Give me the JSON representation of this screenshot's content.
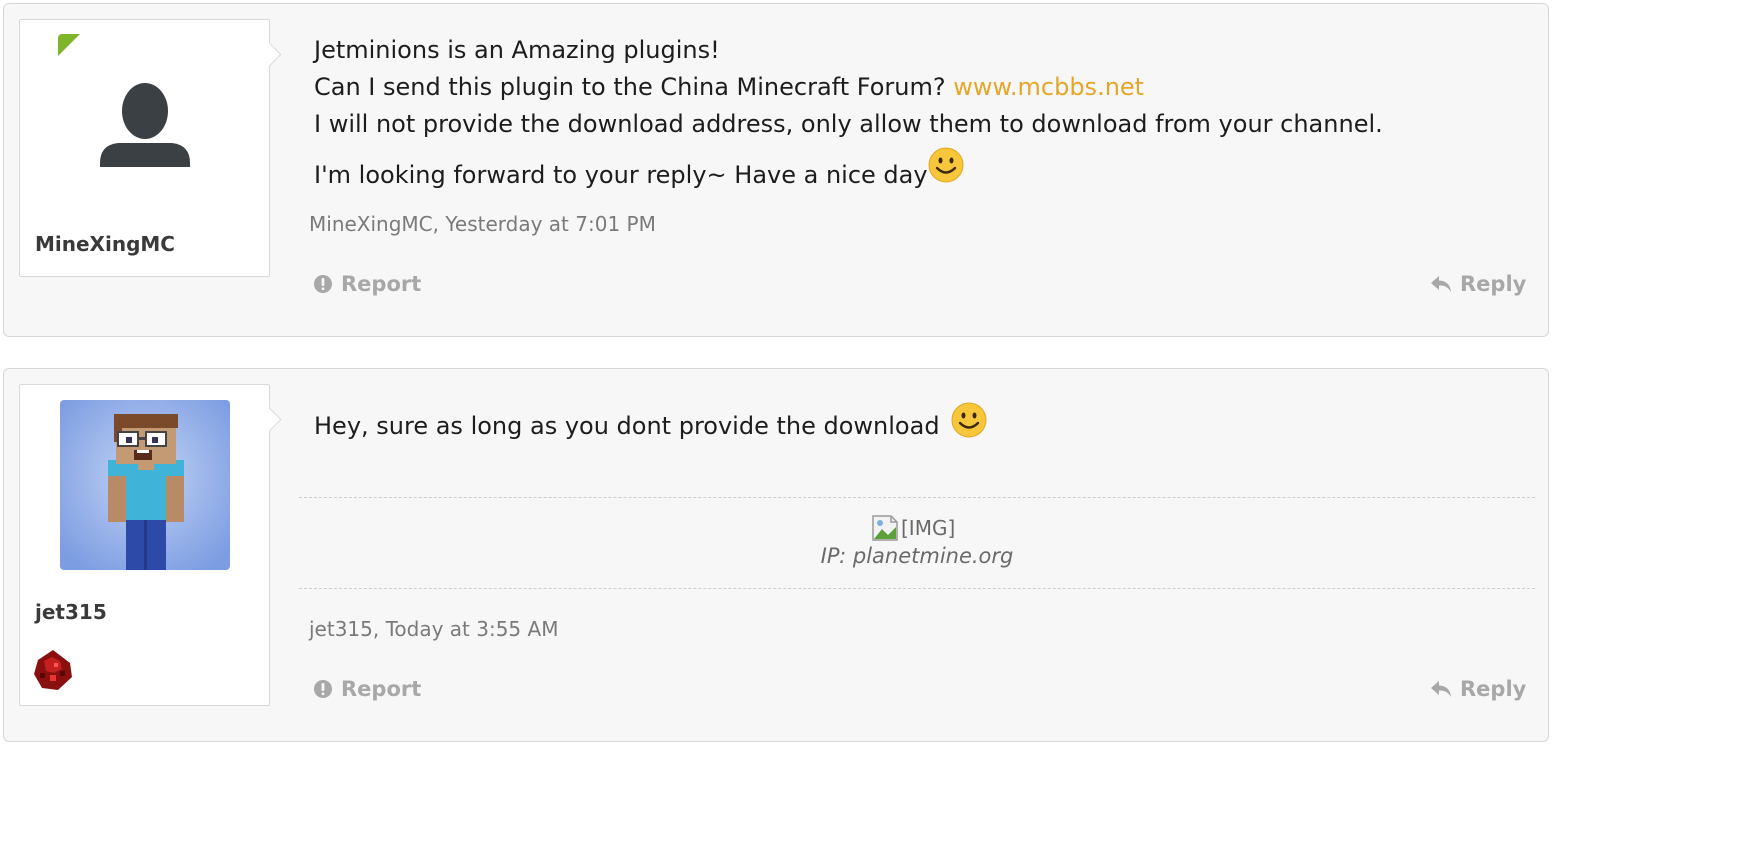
{
  "posts": [
    {
      "username": "MineXingMC",
      "message_lines": [
        {
          "text": "Jetminions is an Amazing plugins!"
        },
        {
          "text": "Can I send this plugin to the China Minecraft Forum? ",
          "link": "www.mcbbs.net"
        },
        {
          "text": "I will not provide the download address, only allow them to download from your channel."
        },
        {
          "text": "I'm looking forward to your reply~ Have a nice day"
        }
      ],
      "meta": "MineXingMC, Yesterday at 7:01 PM",
      "report_label": "Report",
      "reply_label": "Reply"
    },
    {
      "username": "jet315",
      "message_lines": [
        {
          "text": "Hey, sure as long as you dont provide the download "
        }
      ],
      "signature": {
        "image_alt": "[IMG]",
        "ip_text": "IP: planetmine.org"
      },
      "meta": "jet315, Today at 3:55 AM",
      "report_label": "Report",
      "reply_label": "Reply"
    }
  ],
  "colors": {
    "link": "#e6a628",
    "new_indicator": "#7fb42b",
    "action_text": "#a8a8a8",
    "meta_text": "#7a7a7a",
    "post_background": "#f7f7f7"
  },
  "icons": {
    "new_post_corner": "new-indicator-corner",
    "default_avatar": "user-silhouette-icon",
    "smiley": "smiley-face-icon",
    "report": "exclamation-circle-icon",
    "reply": "reply-arrow-icon",
    "badge": "redstone-dust-icon"
  }
}
